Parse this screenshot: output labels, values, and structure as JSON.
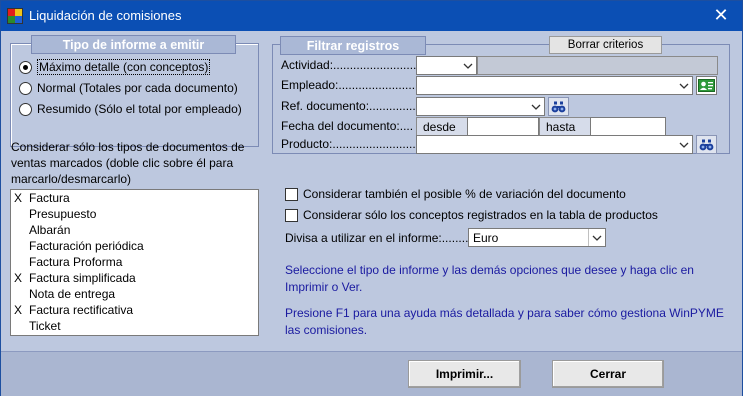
{
  "window": {
    "title": "Liquidación de comisiones",
    "close_glyph": "✕"
  },
  "report_type": {
    "header": "Tipo de informe a emitir",
    "options": [
      {
        "label": "Máximo detalle (con conceptos)",
        "checked": true
      },
      {
        "label": "Normal (Totales por cada documento)",
        "checked": false
      },
      {
        "label": "Resumido (Sólo el total por empleado)",
        "checked": false
      }
    ]
  },
  "doc_types": {
    "instruction": "Considerar sólo los tipos de documentos de ventas marcados (doble clic sobre él para marcarlo/desmarcarlo)",
    "items": [
      {
        "mark": "X",
        "name": "Factura"
      },
      {
        "mark": "",
        "name": "Presupuesto"
      },
      {
        "mark": "",
        "name": "Albarán"
      },
      {
        "mark": "",
        "name": "Facturación periódica"
      },
      {
        "mark": "",
        "name": "Factura Proforma"
      },
      {
        "mark": "X",
        "name": "Factura simplificada"
      },
      {
        "mark": "",
        "name": "Nota de entrega"
      },
      {
        "mark": "X",
        "name": "Factura rectificativa"
      },
      {
        "mark": "",
        "name": "Ticket"
      }
    ]
  },
  "filters": {
    "header": "Filtrar registros",
    "clear_button": "Borrar criterios",
    "actividad_label": "Actividad:.............................",
    "empleado_label": "Empleado:.............................",
    "ref_label": "Ref. documento:...................",
    "fecha_label": "Fecha del documento:....",
    "desde_label": "desde",
    "hasta_label": "hasta",
    "producto_label": "Producto:..............................."
  },
  "options": {
    "variation_label": "Considerar también el posible % de variación del documento",
    "products_label": "Considerar sólo los conceptos registrados en la tabla de productos",
    "currency_label": "Divisa a utilizar en el informe:........",
    "currency_value": "Euro"
  },
  "help": {
    "line1": "Seleccione el tipo de informe y las demás opciones que desee y haga clic en Imprimir o Ver.",
    "line2": "Presione F1 para una ayuda más detallada y para saber cómo gestiona WinPYME las comisiones."
  },
  "footer": {
    "print_button": "Imprimir...",
    "close_button": "Cerrar"
  },
  "icons": {
    "dropdown": "chevron-down-icon",
    "search": "binoculars-icon",
    "person": "person-card-icon"
  }
}
